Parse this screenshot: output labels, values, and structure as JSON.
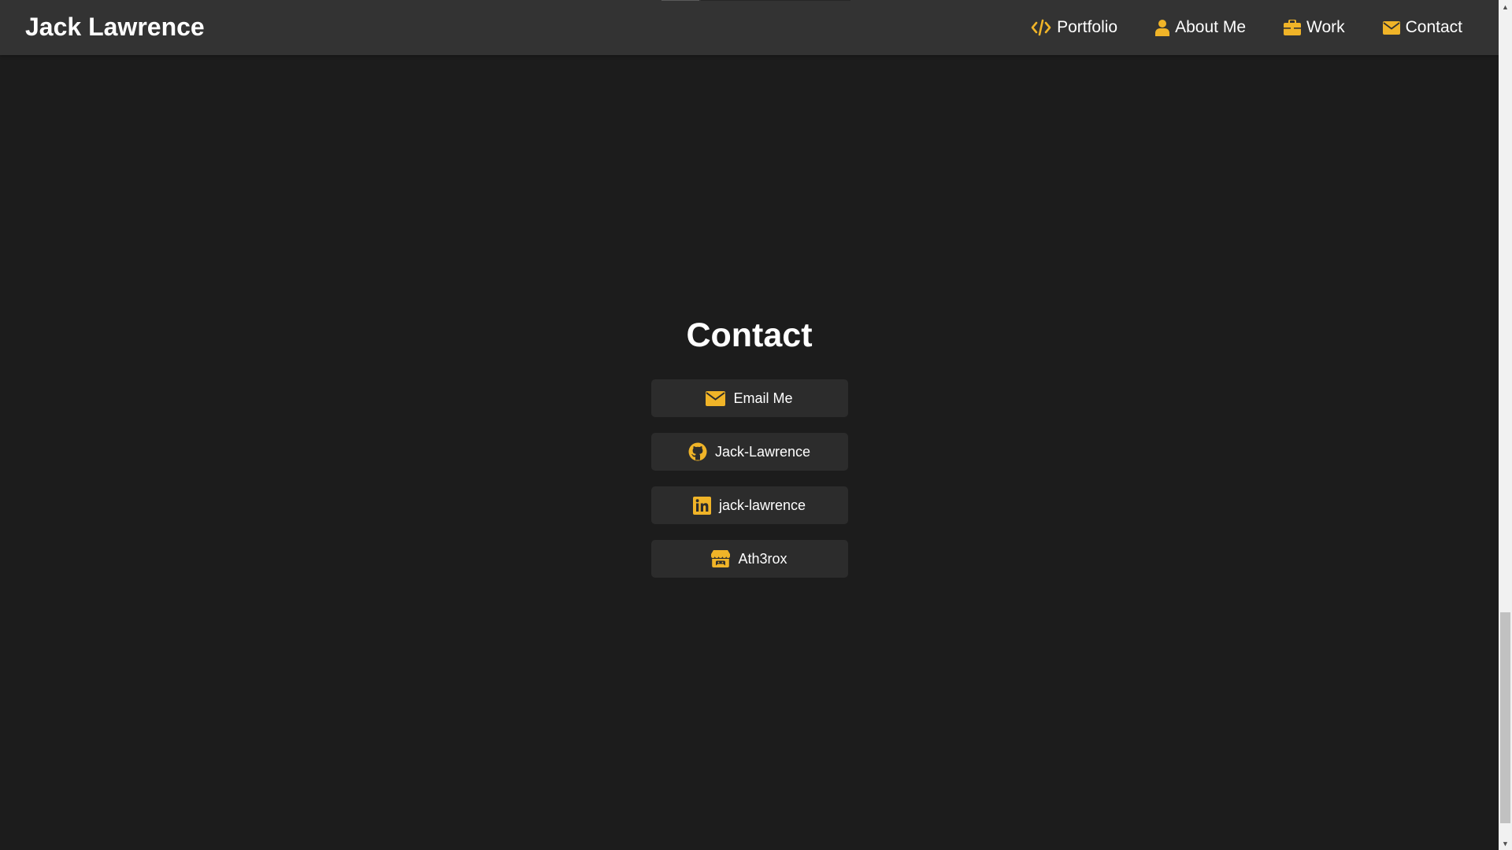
{
  "brand": {
    "name": "Jack Lawrence"
  },
  "nav": {
    "items": [
      {
        "label": "Portfolio",
        "icon": "code-icon"
      },
      {
        "label": "About Me",
        "icon": "user-icon"
      },
      {
        "label": "Work",
        "icon": "briefcase-icon"
      },
      {
        "label": "Contact",
        "icon": "envelope-icon"
      }
    ]
  },
  "contact": {
    "title": "Contact",
    "links": [
      {
        "label": "Email Me",
        "icon": "envelope-icon"
      },
      {
        "label": "Jack-Lawrence",
        "icon": "github-icon"
      },
      {
        "label": "jack-lawrence",
        "icon": "linkedin-icon"
      },
      {
        "label": "Ath3rox",
        "icon": "itch-io-icon"
      }
    ]
  },
  "colors": {
    "accent": "#f0b428",
    "background": "#1c1c1c",
    "navbar": "#333333",
    "button": "#2c2c2c",
    "text": "#ffffff"
  }
}
